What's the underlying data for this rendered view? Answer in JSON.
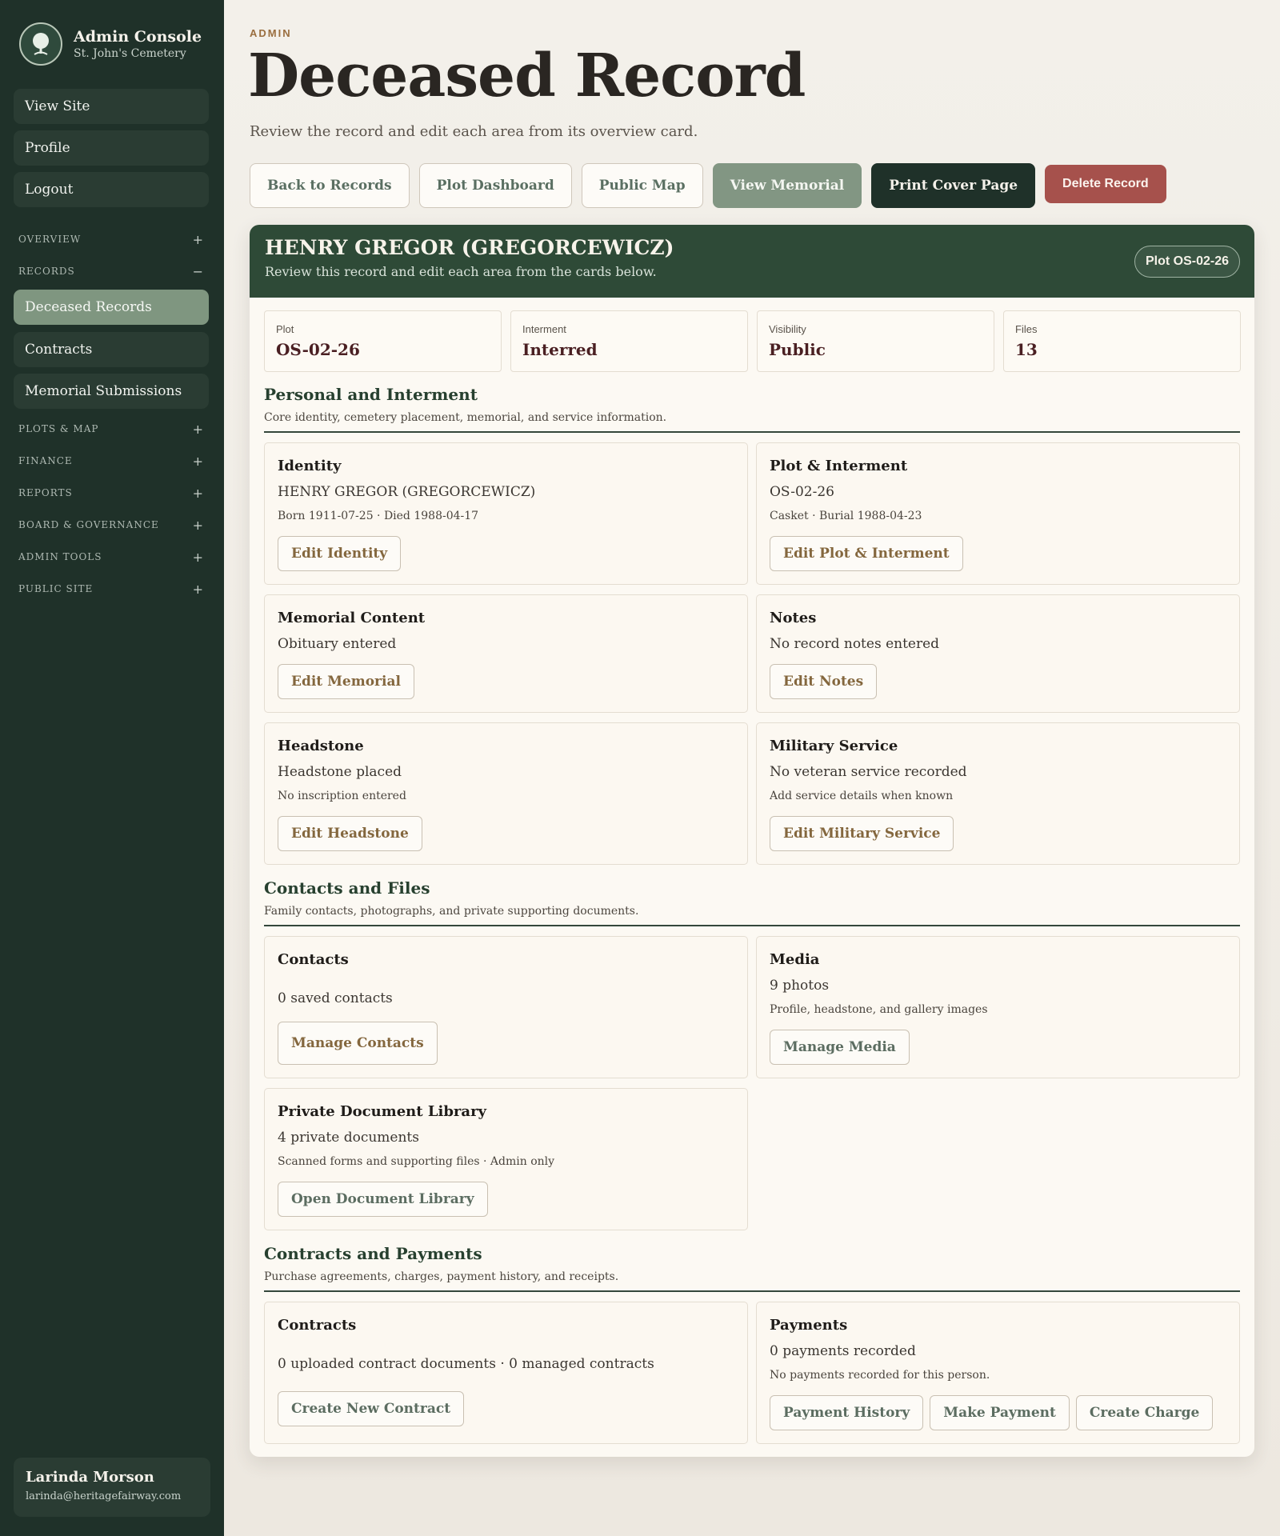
{
  "sidebar": {
    "brand_title": "Admin Console",
    "brand_sub": "St. John's Cemetery",
    "top_links": [
      "View Site",
      "Profile",
      "Logout"
    ],
    "sections": {
      "overview": {
        "label": "OVERVIEW",
        "toggle": "+"
      },
      "records": {
        "label": "RECORDS",
        "toggle": "−"
      },
      "plots_map": {
        "label": "PLOTS & MAP",
        "toggle": "+"
      },
      "finance": {
        "label": "FINANCE",
        "toggle": "+"
      },
      "reports": {
        "label": "REPORTS",
        "toggle": "+"
      },
      "board": {
        "label": "BOARD & GOVERNANCE",
        "toggle": "+"
      },
      "admin_tools": {
        "label": "ADMIN TOOLS",
        "toggle": "+"
      },
      "public_site": {
        "label": "PUBLIC SITE",
        "toggle": "+"
      }
    },
    "records_items": [
      "Deceased Records",
      "Contracts",
      "Memorial Submissions"
    ],
    "active_item": "Deceased Records",
    "user": {
      "name": "Larinda Morson",
      "email": "larinda@heritagefairway.com"
    }
  },
  "header": {
    "eyebrow": "ADMIN",
    "title": "Deceased Record",
    "subtitle": "Review the record and edit each area from its overview card.",
    "actions": {
      "back": "Back to Records",
      "plot_dashboard": "Plot Dashboard",
      "public_map": "Public Map",
      "view_memorial": "View Memorial",
      "print_cover": "Print Cover Page",
      "delete": "Delete Record"
    }
  },
  "record": {
    "name": "HENRY GREGOR (GREGORCEWICZ)",
    "subtitle": "Review this record and edit each area from the cards below.",
    "plot_pill": "Plot OS-02-26",
    "stats": [
      {
        "label": "Plot",
        "value": "OS-02-26"
      },
      {
        "label": "Interment",
        "value": "Interred"
      },
      {
        "label": "Visibility",
        "value": "Public"
      },
      {
        "label": "Files",
        "value": "13"
      }
    ]
  },
  "sections": {
    "personal": {
      "title": "Personal and Interment",
      "desc": "Core identity, cemetery placement, memorial, and service information."
    },
    "contacts": {
      "title": "Contacts and Files",
      "desc": "Family contacts, photographs, and private supporting documents."
    },
    "contracts": {
      "title": "Contracts and Payments",
      "desc": "Purchase agreements, charges, payment history, and receipts."
    }
  },
  "cards": {
    "identity": {
      "title": "Identity",
      "main": "HENRY GREGOR (GREGORCEWICZ)",
      "sub": "Born 1911-07-25 · Died 1988-04-17",
      "button": "Edit Identity"
    },
    "plot": {
      "title": "Plot & Interment",
      "main": "OS-02-26",
      "sub": "Casket · Burial 1988-04-23",
      "button": "Edit Plot & Interment"
    },
    "memorial": {
      "title": "Memorial Content",
      "main": "Obituary entered",
      "button": "Edit Memorial"
    },
    "notes": {
      "title": "Notes",
      "main": "No record notes entered",
      "button": "Edit Notes"
    },
    "headstone": {
      "title": "Headstone",
      "main": "Headstone placed",
      "sub": "No inscription entered",
      "button": "Edit Headstone"
    },
    "military": {
      "title": "Military Service",
      "main": "No veteran service recorded",
      "sub": "Add service details when known",
      "button": "Edit Military Service"
    },
    "contacts": {
      "title": "Contacts",
      "main": "0 saved contacts",
      "button": "Manage Contacts"
    },
    "media": {
      "title": "Media",
      "main": "9 photos",
      "sub": "Profile, headstone, and gallery images",
      "button": "Manage Media"
    },
    "documents": {
      "title": "Private Document Library",
      "main": "4 private documents",
      "sub": "Scanned forms and supporting files · Admin only",
      "button": "Open Document Library"
    },
    "contracts": {
      "title": "Contracts",
      "main": "0 uploaded contract documents · 0 managed contracts",
      "button": "Create New Contract"
    },
    "payments": {
      "title": "Payments",
      "main": "0 payments recorded",
      "sub": "No payments recorded for this person.",
      "buttons": [
        "Payment History",
        "Make Payment",
        "Create Charge"
      ]
    }
  }
}
